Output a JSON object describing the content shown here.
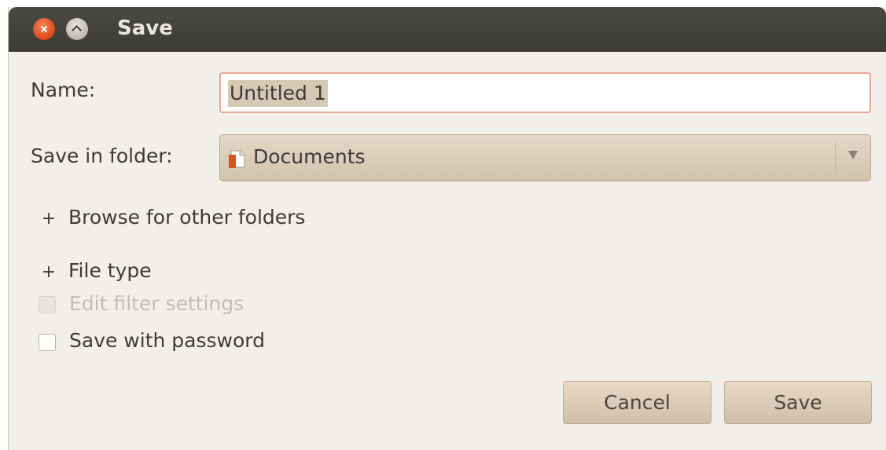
{
  "window": {
    "title": "Save",
    "close_icon": "close-icon",
    "minimize_icon": "minimize-icon"
  },
  "form": {
    "name_label": "Name:",
    "name_value": "Untitled 1",
    "folder_label": "Save in folder:",
    "folder_value": "Documents",
    "folder_icon": "folder-documents-icon"
  },
  "expanders": {
    "browse_symbol": "+",
    "browse_label": "Browse for other folders",
    "filetype_symbol": "+",
    "filetype_label": "File type"
  },
  "options": {
    "edit_filter_label": "Edit filter settings",
    "edit_filter_checked": false,
    "edit_filter_enabled": false,
    "password_label": "Save with password",
    "password_checked": false
  },
  "buttons": {
    "cancel_label": "Cancel",
    "save_label": "Save"
  },
  "colors": {
    "titlebar": "#3c3b37",
    "close_button": "#dd4814",
    "dialog_background": "#f2efeb",
    "button_background": "#ddcbb6",
    "focus_border": "#e9a595"
  }
}
